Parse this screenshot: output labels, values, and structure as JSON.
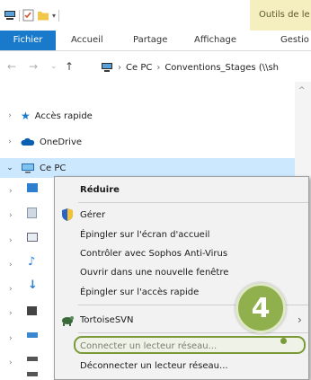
{
  "title_bar": {
    "tools_tab_label": "Outils de le"
  },
  "ribbon": {
    "tabs": [
      "Fichier",
      "Accueil",
      "Partage",
      "Affichage",
      "Gestio"
    ]
  },
  "address_bar": {
    "segments": [
      "Ce PC",
      "Conventions_Stages (\\\\sh"
    ]
  },
  "nav_pane": {
    "items": [
      "Accès rapide",
      "OneDrive",
      "Ce PC"
    ]
  },
  "context_menu": {
    "items": [
      "Réduire",
      "Gérer",
      "Épingler sur l'écran d'accueil",
      "Contrôler avec Sophos Anti-Virus",
      "Ouvrir dans une nouvelle fenêtre",
      "Épingler sur l'accès rapide",
      "TortoiseSVN",
      "Connecter un lecteur réseau...",
      "Déconnecter un lecteur réseau..."
    ]
  },
  "annotation": {
    "step_number": "4"
  },
  "colors": {
    "accent": "#1979ca",
    "highlight": "#8fb04c",
    "selection": "#cce8ff"
  }
}
